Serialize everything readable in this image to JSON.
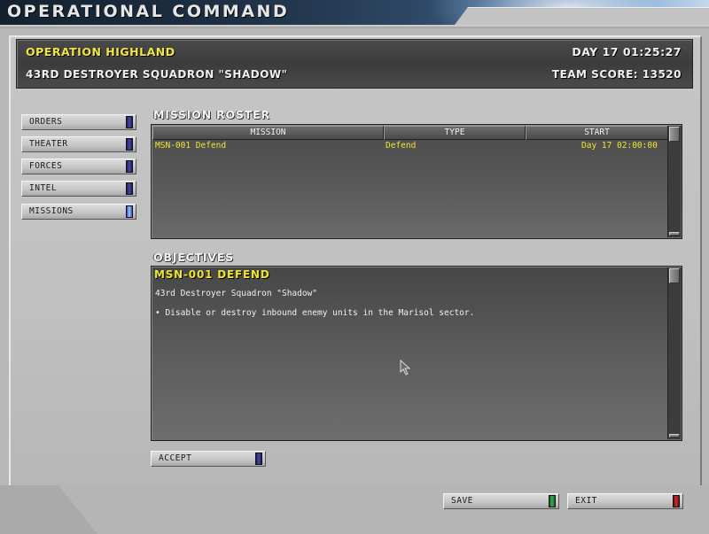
{
  "window": {
    "title": "OPERATIONAL COMMAND"
  },
  "header": {
    "operation": "OPERATION HIGHLAND",
    "day_time": "DAY 17 01:25:27",
    "squadron": "43RD DESTROYER SQUADRON \"SHADOW\"",
    "team_score": "TEAM SCORE: 13520"
  },
  "nav": {
    "items": [
      {
        "label": "ORDERS",
        "active": false
      },
      {
        "label": "THEATER",
        "active": false
      },
      {
        "label": "FORCES",
        "active": false
      },
      {
        "label": "INTEL",
        "active": false
      },
      {
        "label": "MISSIONS",
        "active": true
      }
    ]
  },
  "roster": {
    "title": "MISSION ROSTER",
    "columns": [
      "MISSION",
      "TYPE",
      "START"
    ],
    "rows": [
      {
        "mission": "MSN-001 Defend",
        "type": "Defend",
        "start": "Day 17 02:00:00"
      }
    ]
  },
  "objectives": {
    "title": "OBJECTIVES",
    "heading": "MSN-001 DEFEND",
    "subtitle": "43rd Destroyer Squadron \"Shadow\"",
    "bullet": "• Disable or destroy inbound enemy units in the Marisol sector."
  },
  "buttons": {
    "accept": "ACCEPT",
    "save": "SAVE",
    "exit": "EXIT"
  },
  "colors": {
    "accent_yellow": "#f0e430",
    "led_blue": "#4a4aa8",
    "led_green": "#2e8a3a",
    "led_red": "#a81c1c"
  }
}
